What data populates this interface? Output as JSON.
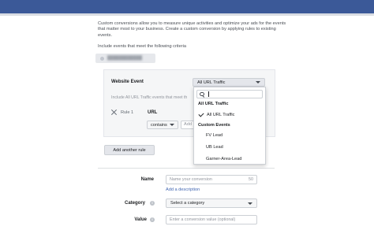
{
  "intro_text": "Custom conversions allow you to measure unique activities and optimize your ads for the events that matter most to your business. Create a custom conversion by applying rules to existing events.",
  "criteria_label": "Include events that meet the following criteria",
  "rule_builder": {
    "event_label": "Website Event",
    "event_selected": "All URL Traffic",
    "include_note": "Include All URL Traffic events that meet th",
    "rule_label": "Rule 1",
    "field_label": "URL",
    "operator": "contains",
    "value_placeholder": "Add",
    "add_rule_label": "Add another rule"
  },
  "dropdown": {
    "search_value": "",
    "group_all": "All URL Traffic",
    "selected_item": "All URL Traffic",
    "group_custom": "Custom Events",
    "items": [
      "FV Lead",
      "UB Lead",
      "Garner-Area-Lead"
    ]
  },
  "form": {
    "name_label": "Name",
    "name_placeholder": "Name your conversion",
    "name_char_limit": "50",
    "add_description": "Add a description",
    "category_label": "Category",
    "category_selected": "Select a category",
    "value_label": "Value",
    "value_placeholder": "Enter a conversion value (optional)"
  },
  "colors": {
    "topbar": "#3b5998",
    "link": "#4267b2"
  }
}
